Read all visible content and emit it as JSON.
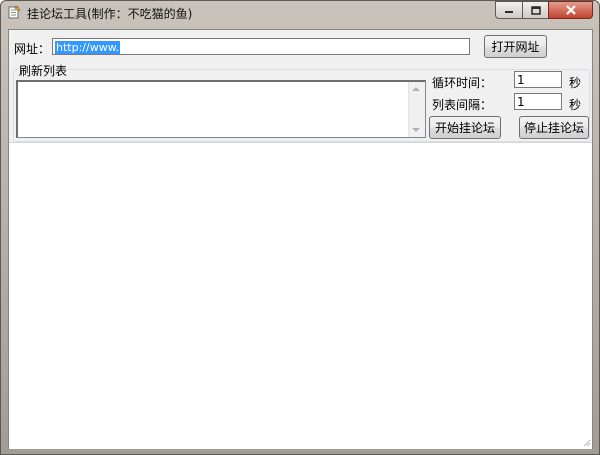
{
  "window": {
    "title": "挂论坛工具(制作：不吃猫的鱼)",
    "icon": "app-notepad-icon"
  },
  "caption_buttons": {
    "minimize_icon": "minimize-icon",
    "maximize_icon": "maximize-icon",
    "close_icon": "close-icon"
  },
  "url_row": {
    "label": "网址：",
    "value": "http://www.",
    "open_button": "打开网址"
  },
  "refresh_group": {
    "legend": "刷新列表",
    "list_items": []
  },
  "settings": {
    "loop_time_label": "循环时间：",
    "loop_time_value": "1",
    "loop_time_unit": "秒",
    "list_interval_label": "列表间隔：",
    "list_interval_value": "1",
    "list_interval_unit": "秒"
  },
  "actions": {
    "start_button": "开始挂论坛",
    "stop_button": "停止挂论坛"
  },
  "colors": {
    "selection": "#3399ff",
    "close_button": "#c2432f",
    "client_bg": "#f0f0f0"
  }
}
